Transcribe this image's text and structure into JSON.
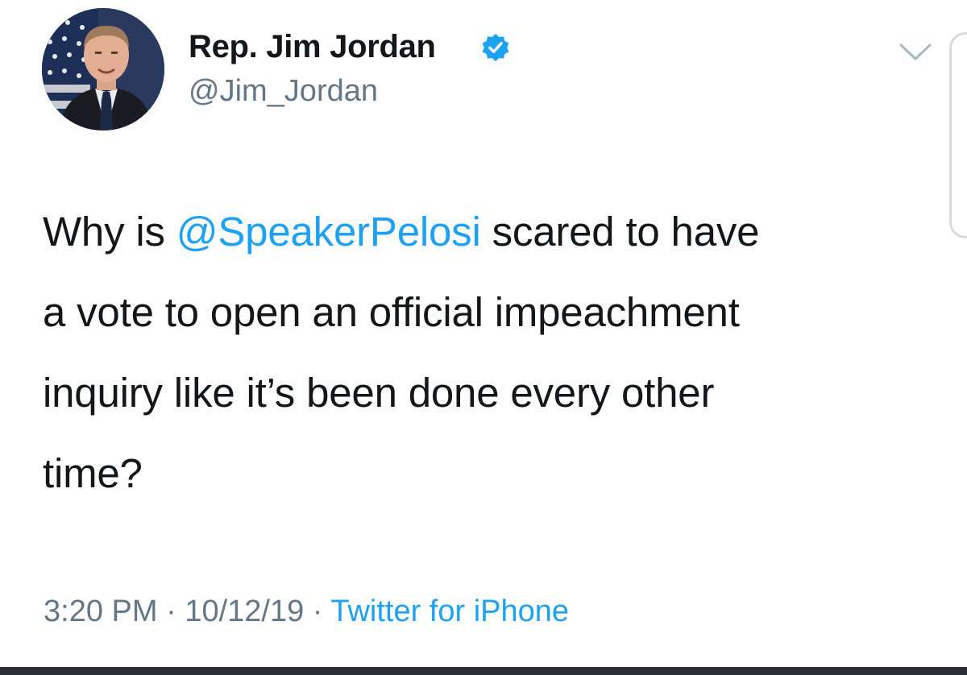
{
  "author": {
    "display_name": "Rep. Jim Jordan",
    "handle": "@Jim_Jordan",
    "verified": true,
    "avatar_icon": "profile-photo"
  },
  "tweet": {
    "line1_pre": "Why is ",
    "mention": "@SpeakerPelosi",
    "line1_post": " scared to have",
    "line2": "a vote to open an official impeachment",
    "line3": "inquiry like it’s been done every other",
    "line4": "time?"
  },
  "meta": {
    "time": "3:20 PM",
    "separator1": " · ",
    "date": "10/12/19",
    "separator2": " · ",
    "source": "Twitter for iPhone"
  },
  "icons": {
    "verified": "verified-badge-icon",
    "menu": "chevron-down-icon"
  },
  "colors": {
    "accent": "#1da1f2",
    "text": "#14171a",
    "secondary": "#657786"
  }
}
